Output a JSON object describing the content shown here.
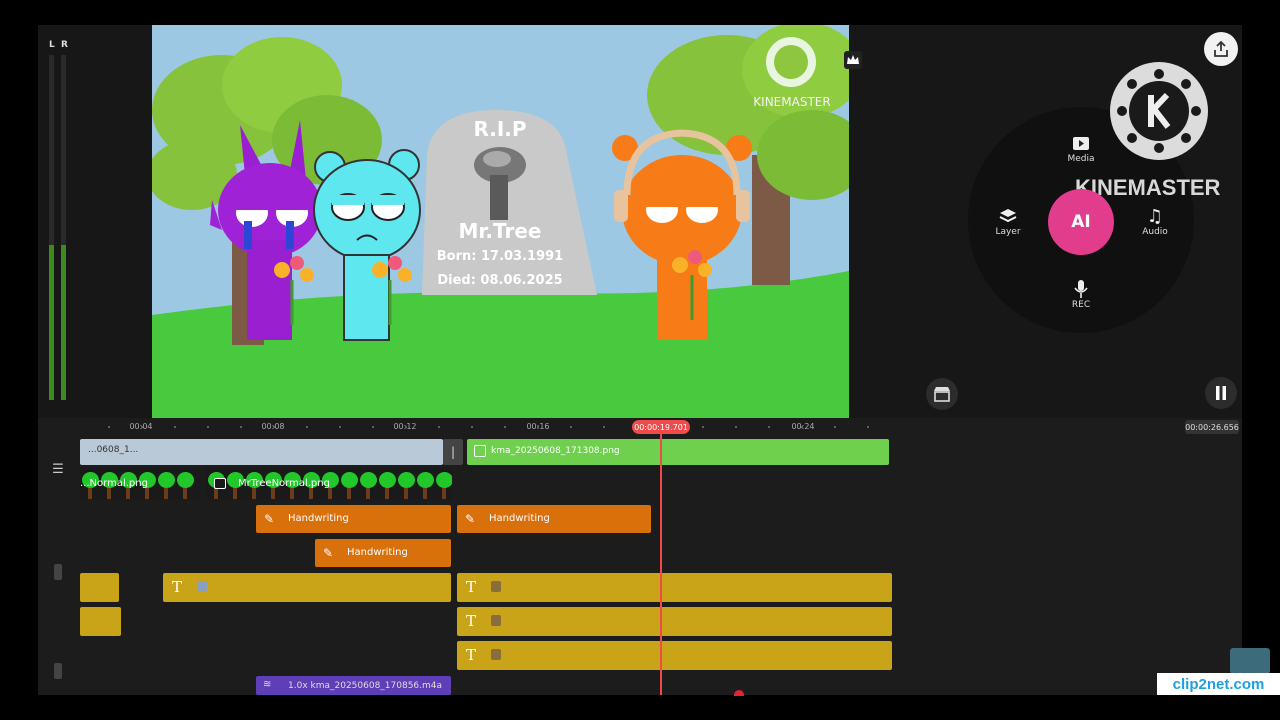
{
  "meters": {
    "left_label": "L",
    "right_label": "R",
    "left_level": 0.45,
    "right_level": 0.45
  },
  "preview": {
    "watermark": "KINEMASTER",
    "tombstone": {
      "title": "R.I.P",
      "name": "Mr.Tree",
      "born": "Born: 17.03.1991",
      "died": "Died: 08.06.2025"
    }
  },
  "right_panel": {
    "brand": "KINEMASTER",
    "tools": {
      "media": "Media",
      "layer": "Layer",
      "ai": "AI",
      "audio": "Audio",
      "rec": "REC"
    }
  },
  "timeline": {
    "ruler": [
      "00:04",
      "00:08",
      "00:12",
      "00:16",
      "00:24"
    ],
    "playhead_time": "00:00:19.701",
    "total_time": "00:00:26.656",
    "video_clip_label": "kma_20250608_171308.png",
    "video_clip_label_left": "...0608_1...",
    "layer_a_label": "...Normal.png",
    "layer_b_label": "MrTreeNormal.png",
    "handwriting_1": "Handwriting",
    "handwriting_2": "Handwriting",
    "handwriting_3": "Handwriting",
    "audio_label": "1.0x kma_20250608_170856.m4a"
  },
  "corner_watermark": "clip2net.com",
  "colors": {
    "accent_playhead": "#f04a4a",
    "ai_button": "#e23c8c",
    "handwriting": "#d8700c",
    "text_layer": "#c9a418",
    "audio_clip": "#5e3fb8",
    "video_track": "#6ed04d"
  }
}
